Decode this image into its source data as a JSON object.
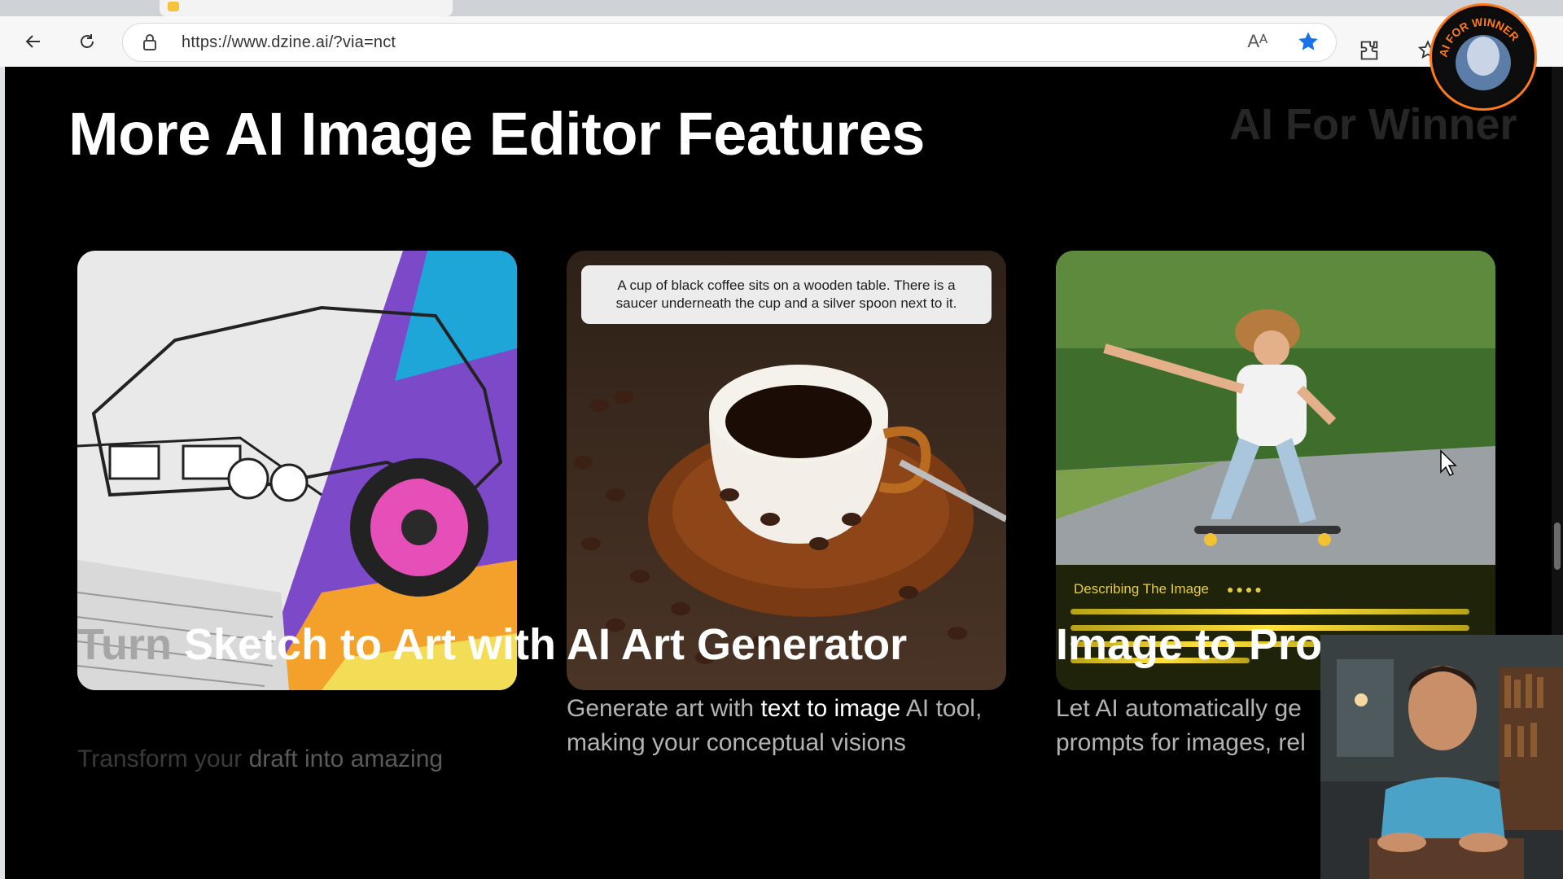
{
  "browser": {
    "url": "https://www.dzine.ai/?via=nct",
    "read_aloud_label": "Aᴬ"
  },
  "page": {
    "heading": "More AI Image Editor Features",
    "watermark": "AI For Winner",
    "cards": [
      {
        "title_fade": "Turn",
        "title_rest": " Sketch to Art with AI",
        "desc_a": "Transform your ",
        "desc_hl": "draft into amazing",
        "desc_b": ""
      },
      {
        "prompt": "A cup of black coffee sits on a wooden table. There is a saucer underneath the cup and a silver spoon next to it.",
        "title": "AI Art Generator",
        "desc_a": "Generate art with ",
        "desc_hl": "text to image",
        "desc_b": " AI tool, making your conceptual visions"
      },
      {
        "describing_label": "Describing The Image",
        "title": "Image to Pro",
        "desc_a": "Let AI automatically ge",
        "desc_b": "prompts for images, rel"
      }
    ]
  },
  "logo": {
    "text": "AI FOR WINNER"
  },
  "colors": {
    "accent_yellow": "#e3cd41",
    "logo_ring": "#ff7a1a",
    "bookmark_blue": "#1a73e8"
  }
}
